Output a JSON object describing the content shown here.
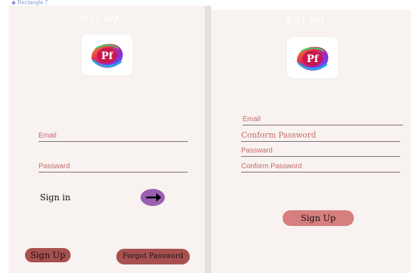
{
  "canvas_label": "◆ Rectangle 7",
  "left_screen": {
    "status_time": "9:41 AM",
    "logo_text": "Pf",
    "email_label": "Email",
    "password_label": "Passward",
    "signin_label": "Sign in",
    "signup_label": "Sign Up",
    "forgot_label": "Forgot Password"
  },
  "right_screen": {
    "status_time": "9:41 AM",
    "logo_text": "Pf",
    "fields": [
      "Email",
      "Conform Password",
      "Passward",
      "Conform Password"
    ],
    "signup_label": "Sign Up"
  },
  "colors": {
    "screen_bg": "#f8f2f0",
    "field_label": "#c46a6a",
    "arrow_button": "#9a5fb0",
    "signup_left": "#a85050",
    "forgot_button": "#a85050",
    "signup_right": "#d67f7f"
  }
}
